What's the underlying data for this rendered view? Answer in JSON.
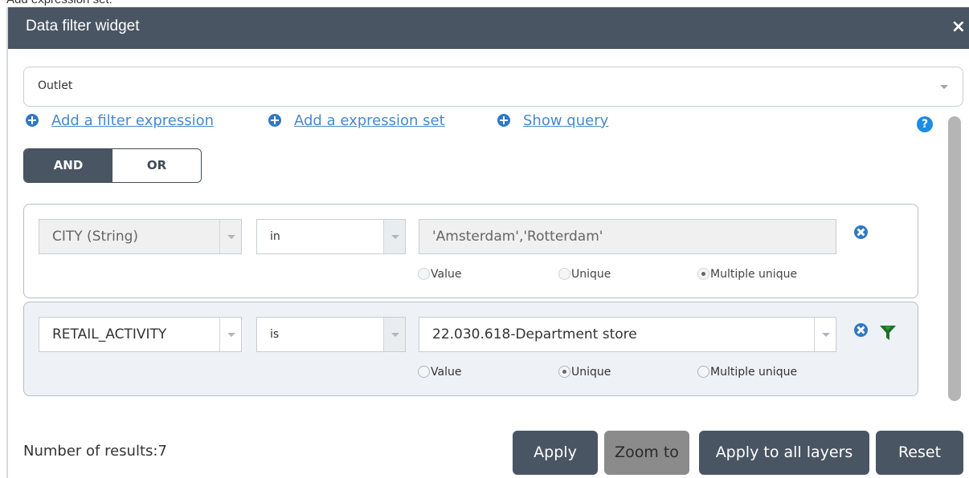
{
  "caption": "Add expression set:",
  "widget": {
    "title": "Data filter widget",
    "close_glyph": "×"
  },
  "layer_select": {
    "value": "Outlet"
  },
  "links": {
    "add_expression": "Add a filter expression",
    "add_set": "Add a expression set",
    "show_query": "Show query"
  },
  "help_glyph": "?",
  "logic": {
    "and": "AND",
    "or": "OR",
    "selected": "AND"
  },
  "expressions": [
    {
      "field": "CITY (String)",
      "operator": "in",
      "value": "'Amsterdam','Rotterdam'",
      "radio_value": "Value",
      "radio_unique": "Unique",
      "radio_multiple": "Multiple unique",
      "selected": "Multiple unique",
      "enabled": false
    },
    {
      "field": "RETAIL_ACTIVITY",
      "operator": "is",
      "value": "22.030.618-Department store",
      "radio_value": "Value",
      "radio_unique": "Unique",
      "radio_multiple": "Multiple unique",
      "selected": "Unique",
      "enabled": true
    }
  ],
  "results_text": "Number of results:7",
  "buttons": {
    "apply": "Apply",
    "zoom_to": "Zoom to",
    "apply_all": "Apply to all layers",
    "reset": "Reset"
  },
  "colors": {
    "titlebar": "#4a5563",
    "link": "#4a89c8",
    "icon_blue": "#2f78c2",
    "funnel": "#1e6f28",
    "zoom_button": "#8b8b8b"
  },
  "icons": [
    "plus-circle-icon",
    "help-icon",
    "remove-circle-icon",
    "filter-funnel-icon",
    "close-icon",
    "chevron-down-icon"
  ]
}
